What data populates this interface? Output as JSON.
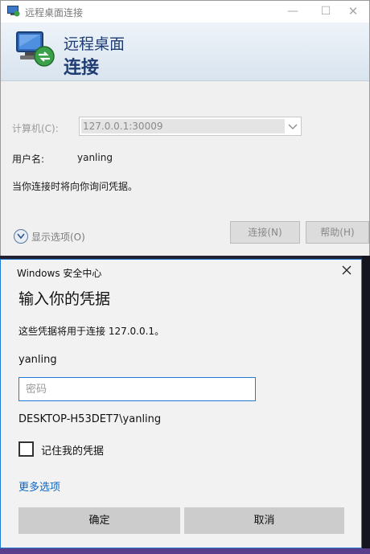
{
  "rdc": {
    "title": "远程桌面连接",
    "banner_line1": "远程桌面",
    "banner_line2": "连接",
    "computer_label": "计算机(C):",
    "computer_value": "127.0.0.1:30009",
    "username_label": "用户名:",
    "username_value": "yanling",
    "prompt_text": "当你连接时将向你询问凭据。",
    "show_options": "显示选项(O)",
    "connect_button": "连接(N)",
    "help_button": "帮助(H)"
  },
  "security": {
    "header": "Windows 安全中心",
    "heading": "输入你的凭据",
    "description": "这些凭据将用于连接 127.0.0.1。",
    "username": "yanling",
    "password_placeholder": "密码",
    "account": "DESKTOP-H53DET7\\yanling",
    "remember_label": "记住我的凭据",
    "more_options": "更多选项",
    "ok_button": "确定",
    "cancel_button": "取消"
  },
  "colors": {
    "accent": "#1f7ad6",
    "link": "#0a66c2",
    "banner_text": "#1f3d73"
  }
}
